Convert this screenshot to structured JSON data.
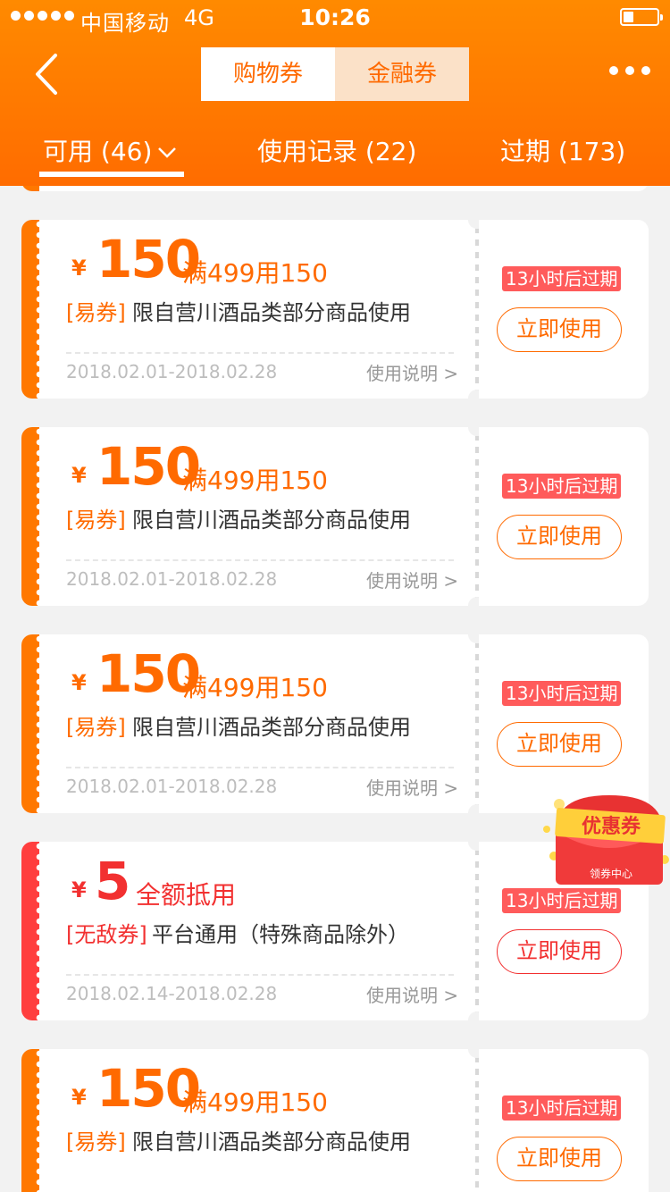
{
  "status_bar": {
    "carrier": "中国移动",
    "network": "4G",
    "time": "10:26",
    "battery_level": 0.3
  },
  "nav": {
    "seg_shopping": "购物券",
    "seg_finance": "金融券",
    "active_segment": "购物券"
  },
  "tabs": {
    "available": "可用 (46)",
    "history": "使用记录 (22)",
    "expired": "过期 (173)",
    "active_tab": "可用 (46)"
  },
  "coupons": [
    {
      "yen": "¥",
      "amount": "150",
      "condition": "满499用150",
      "tag": "[易券]",
      "desc": "限自营川酒品类部分商品使用",
      "date": "2018.02.01-2018.02.28",
      "help": "使用说明 >",
      "expire": "13小时后过期",
      "action": "立即使用",
      "color": "#ff6a00"
    },
    {
      "yen": "¥",
      "amount": "150",
      "condition": "满499用150",
      "tag": "[易券]",
      "desc": "限自营川酒品类部分商品使用",
      "date": "2018.02.01-2018.02.28",
      "help": "使用说明 >",
      "expire": "13小时后过期",
      "action": "立即使用",
      "color": "#ff6a00"
    },
    {
      "yen": "¥",
      "amount": "150",
      "condition": "满499用150",
      "tag": "[易券]",
      "desc": "限自营川酒品类部分商品使用",
      "date": "2018.02.01-2018.02.28",
      "help": "使用说明 >",
      "expire": "13小时后过期",
      "action": "立即使用",
      "color": "#ff6a00"
    },
    {
      "yen": "¥",
      "amount": "5",
      "condition": "全额抵用",
      "tag": "[无敌券]",
      "desc": "平台通用（特殊商品除外）",
      "date": "2018.02.14-2018.02.28",
      "help": "使用说明 >",
      "expire": "13小时后过期",
      "action": "立即使用",
      "color": "#f23030"
    },
    {
      "yen": "¥",
      "amount": "150",
      "condition": "满499用150",
      "tag": "[易券]",
      "desc": "限自营川酒品类部分商品使用",
      "date": "",
      "help": "",
      "expire": "13小时后过期",
      "action": "立即使用",
      "color": "#ff6a00"
    }
  ],
  "floating_badge": {
    "title": "优惠券",
    "subtitle": "领券中心"
  },
  "colors": {
    "header": "#ff7a00",
    "accent": "#ff6a00",
    "red": "#f23030",
    "expire_bg": "#ff5b5b"
  },
  "icons": {
    "back": "back-chevron-icon",
    "more": "more-dots-icon",
    "dropdown": "chevron-down-icon"
  }
}
